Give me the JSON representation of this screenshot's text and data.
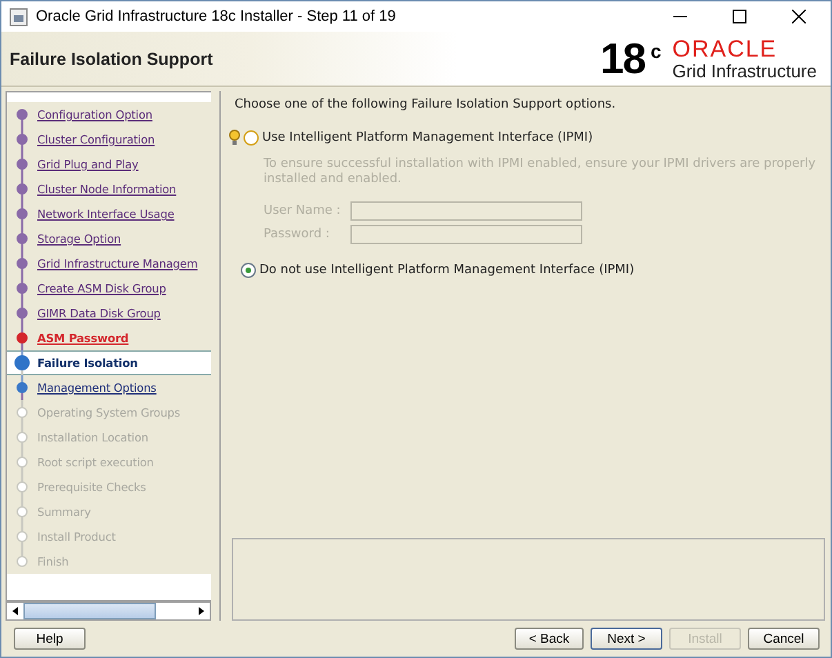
{
  "window": {
    "title": "Oracle Grid Infrastructure 18c Installer - Step 11 of 19"
  },
  "header": {
    "title": "Failure Isolation Support",
    "logo_version": "18",
    "logo_superscript": "c",
    "logo_brand": "ORACLE",
    "logo_product": "Grid Infrastructure"
  },
  "steps": [
    {
      "label": "Configuration Option",
      "kind": "done"
    },
    {
      "label": "Cluster Configuration",
      "kind": "done"
    },
    {
      "label": "Grid Plug and Play",
      "kind": "done"
    },
    {
      "label": "Cluster Node Information",
      "kind": "done"
    },
    {
      "label": "Network Interface Usage",
      "kind": "done"
    },
    {
      "label": "Storage Option",
      "kind": "done"
    },
    {
      "label": "Grid Infrastructure Managem",
      "kind": "done"
    },
    {
      "label": "Create ASM Disk Group",
      "kind": "done"
    },
    {
      "label": "GIMR Data Disk Group",
      "kind": "done"
    },
    {
      "label": "ASM Password",
      "kind": "warning"
    },
    {
      "label": "Failure Isolation",
      "kind": "current"
    },
    {
      "label": "Management Options",
      "kind": "next"
    },
    {
      "label": "Operating System Groups",
      "kind": "pending"
    },
    {
      "label": "Installation Location",
      "kind": "pending"
    },
    {
      "label": "Root script execution",
      "kind": "pending"
    },
    {
      "label": "Prerequisite Checks",
      "kind": "pending"
    },
    {
      "label": "Summary",
      "kind": "pending"
    },
    {
      "label": "Install Product",
      "kind": "pending"
    },
    {
      "label": "Finish",
      "kind": "pending"
    }
  ],
  "content": {
    "prompt": "Choose one of the following Failure Isolation Support options.",
    "options": [
      {
        "label": "Use Intelligent Platform Management Interface (IPMI)",
        "selected": false
      },
      {
        "label": "Do not use Intelligent Platform Management Interface (IPMI)",
        "selected": true
      }
    ],
    "ipmi_note": "To ensure successful installation with IPMI enabled, ensure your IPMI drivers are properly installed and enabled.",
    "fields": [
      {
        "label": "User Name :",
        "disabled": true
      },
      {
        "label": "Password :",
        "disabled": true
      }
    ]
  },
  "buttons": {
    "help": "Help",
    "back": "< Back",
    "next": "Next >",
    "install": {
      "label": "Install",
      "disabled": true
    },
    "cancel": "Cancel"
  }
}
